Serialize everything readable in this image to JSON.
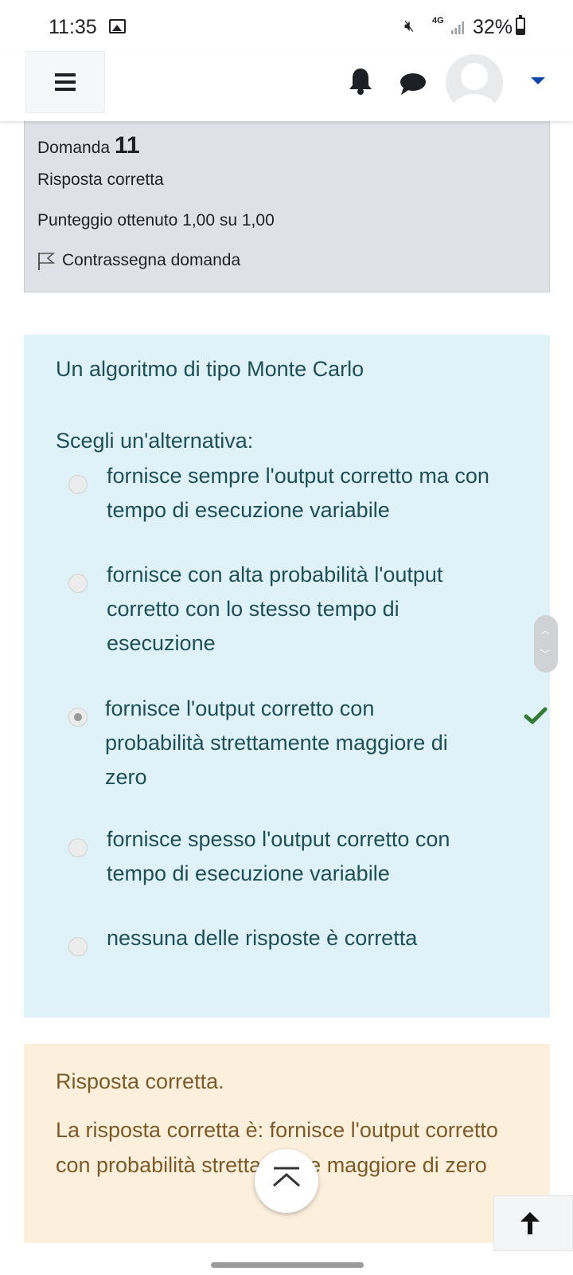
{
  "status_bar": {
    "time": "11:35",
    "network": "4G",
    "battery": "32%",
    "battery_level": 0.32,
    "icons": [
      "gallery-icon",
      "mute-icon",
      "signal-icon",
      "battery-icon"
    ]
  },
  "navbar": {
    "icons": [
      "menu-icon",
      "bell-icon",
      "chat-icon",
      "avatar",
      "caret-down-icon"
    ],
    "accent": "#0f47ad"
  },
  "question_info": {
    "label": "Domanda",
    "number": "11",
    "state": "Risposta corretta",
    "grade": "Punteggio ottenuto 1,00 su 1,00",
    "flag_label": "Contrassegna domanda"
  },
  "question": {
    "text": "Un algoritmo di tipo Monte Carlo",
    "prompt": "Scegli un'alternativa:",
    "options": [
      {
        "label": "fornisce sempre l'output corretto ma con tempo di esecuzione variabile",
        "checked": false
      },
      {
        "label": "fornisce con alta probabilità l'output corretto con lo stesso tempo di esecuzione",
        "checked": false
      },
      {
        "label": "fornisce l'output corretto con probabilità strettamente maggiore di zero",
        "checked": true,
        "correct": true
      },
      {
        "label": "fornisce spesso l'output corretto con tempo di esecuzione variabile",
        "checked": false
      },
      {
        "label": "nessuna delle risposte è corretta",
        "checked": false
      }
    ]
  },
  "feedback": {
    "title": "Risposta corretta.",
    "answer": "La risposta corretta è: fornisce l'output corretto con probabilità strettamente maggiore di zero"
  },
  "colors": {
    "question_bg": "#def2f8",
    "question_text": "#1e4e58",
    "feedback_bg": "#fcefdc",
    "feedback_text": "#7d5a29",
    "info_bg": "#dee2e6",
    "check_green": "#357a32"
  }
}
